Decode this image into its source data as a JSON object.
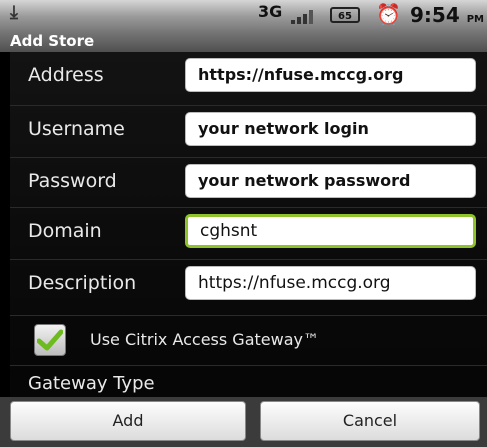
{
  "status_bar": {
    "notification_icon": "download-icon",
    "network": "3G",
    "signal_icon": "signal-bars-icon",
    "battery": "65",
    "alarm_icon": "alarm-clock-icon",
    "time": "9:54",
    "ampm": "PM"
  },
  "title": "Add Store",
  "fields": {
    "address": {
      "label": "Address",
      "value": "https://nfuse.mccg.org"
    },
    "username": {
      "label": "Username",
      "value": "your network login"
    },
    "password": {
      "label": "Password",
      "value": "your network password"
    },
    "domain": {
      "label": "Domain",
      "value": "cghsnt"
    },
    "description": {
      "label": "Description",
      "value": "https://nfuse.mccg.org"
    }
  },
  "checkbox": {
    "label": "Use Citrix Access Gateway™",
    "checked": true
  },
  "gateway_type_label": "Gateway Type",
  "buttons": {
    "add": "Add",
    "cancel": "Cancel"
  },
  "colors": {
    "focus_accent": "#8fc22b",
    "check_green": "#6dbb1e"
  }
}
